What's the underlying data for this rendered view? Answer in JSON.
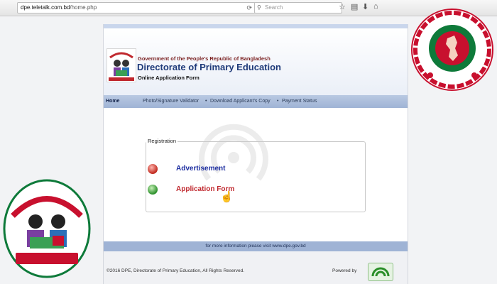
{
  "browser": {
    "url_host": "dpe.teletalk.com.bd",
    "url_path": "/home.php",
    "search_placeholder": "Search",
    "reload_icon": "reload-icon",
    "star_icon": "star-icon",
    "bookmark_icon": "bookmark-icon",
    "download_icon": "download-icon",
    "home_icon": "home-icon"
  },
  "header": {
    "gov_line": "Government of the People's Republic of Bangladesh",
    "title": "Directorate of Primary Education",
    "subtitle": "Online Application Form"
  },
  "nav": {
    "home": "Home",
    "items": [
      {
        "label": "Photo/Signature Validator"
      },
      {
        "label": "Download Applicant's Copy"
      },
      {
        "label": "Payment Status"
      }
    ]
  },
  "registration": {
    "label": "Registration",
    "advertisement": "Advertisement",
    "application_form": "Application Form"
  },
  "info": {
    "text": "for more information please visit www.dpe.gov.bd"
  },
  "footer": {
    "copyright": "©2016 DPE, Directorate of Primary Education, All Rights Reserved.",
    "powered_by": "Powered by"
  },
  "colors": {
    "title": "#1f3b7a",
    "nav": "#9fb3d5",
    "advertisement": "#1d2ea0",
    "application_form": "#c0282e",
    "emblem_red": "#c8102e",
    "emblem_green": "#0e7a3a"
  }
}
